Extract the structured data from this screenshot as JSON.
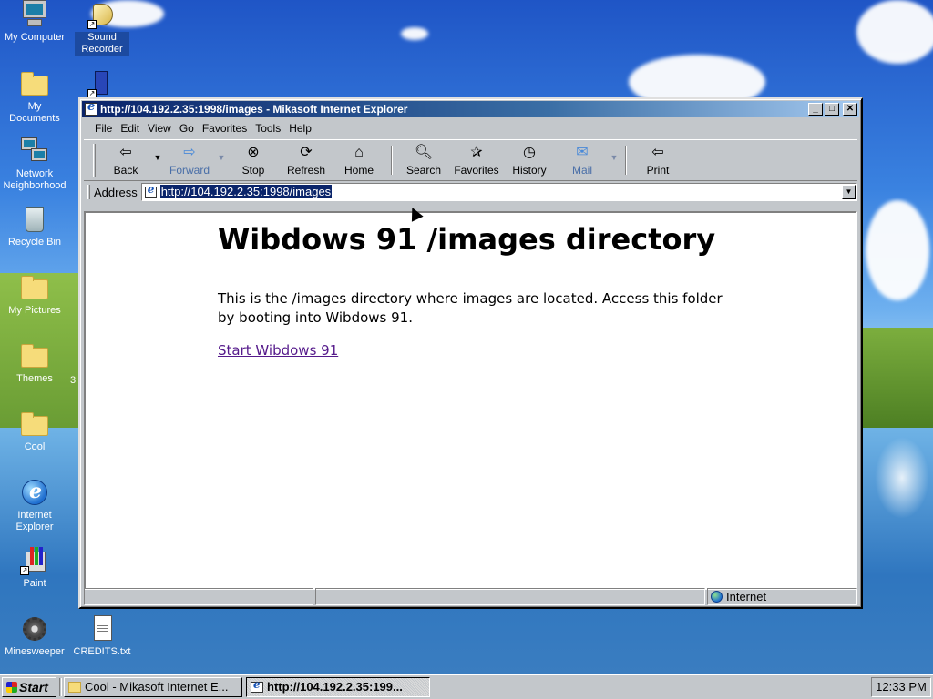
{
  "desktop": {
    "icons": [
      {
        "label": "My Computer"
      },
      {
        "label": "Sound Recorder"
      },
      {
        "label": "My Documents"
      },
      {
        "label": "Network Neighborhood"
      },
      {
        "label": "Recycle Bin"
      },
      {
        "label": "My Pictures"
      },
      {
        "label": "Themes"
      },
      {
        "label": "Cool"
      },
      {
        "label": "Internet Explorer"
      },
      {
        "label": "Paint"
      },
      {
        "label": "Minesweeper"
      },
      {
        "label": "CREDITS.txt"
      }
    ],
    "stray_text": "3"
  },
  "window": {
    "title": "http://104.192.2.35:1998/images - Mikasoft Internet Explorer",
    "buttons": {
      "minimize": "_",
      "maximize": "□",
      "close": "✕"
    },
    "menu": [
      "File",
      "Edit",
      "View",
      "Go",
      "Favorites",
      "Tools",
      "Help"
    ],
    "toolbar": {
      "back": "Back",
      "forward": "Forward",
      "stop": "Stop",
      "refresh": "Refresh",
      "home": "Home",
      "search": "Search",
      "favorites": "Favorites",
      "history": "History",
      "mail": "Mail",
      "print": "Print"
    },
    "address": {
      "label": "Address",
      "value": "http://104.192.2.35:1998/images"
    },
    "page": {
      "heading": "Wibdows 91 /images directory",
      "body": "This is the /images directory where images are located. Access this folder by booting into Wibdows 91.",
      "link": "Start Wibdows 91"
    },
    "status": {
      "zone": "Internet"
    }
  },
  "taskbar": {
    "start": "Start",
    "tasks": [
      {
        "label": "Cool - Mikasoft Internet E...",
        "active": false
      },
      {
        "label": "http://104.192.2.35:199...",
        "active": true
      }
    ],
    "clock": "12:33 PM"
  }
}
